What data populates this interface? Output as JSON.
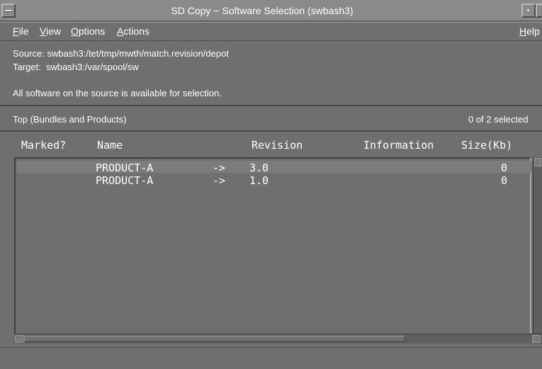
{
  "window": {
    "title": "SD Copy − Software Selection (swbash3)"
  },
  "menubar": {
    "items": [
      {
        "label": "File",
        "mnemonic": "F",
        "rest": "ile"
      },
      {
        "label": "View",
        "mnemonic": "V",
        "rest": "iew"
      },
      {
        "label": "Options",
        "mnemonic": "O",
        "rest": "ptions"
      },
      {
        "label": "Actions",
        "mnemonic": "A",
        "rest": "ctions"
      }
    ],
    "help": {
      "label": "Help",
      "mnemonic": "H",
      "rest": "elp"
    }
  },
  "info": {
    "source": "Source: swbash3:/tet/tmp/mwth/match.revision/depot",
    "target": "Target:  swbash3:/var/spool/sw",
    "message": "All software on the source is available for selection."
  },
  "level": {
    "label": "Top (Bundles and Products)",
    "selection_count": "0 of 2 selected"
  },
  "columns": {
    "marked": "Marked?",
    "name": "Name",
    "revision": "Revision",
    "information": "Information",
    "size": "Size(Kb)"
  },
  "rows": [
    {
      "marked": "",
      "name": "PRODUCT-A",
      "arrow": "->",
      "revision": "3.0",
      "information": "",
      "size": "0",
      "selected": true
    },
    {
      "marked": "",
      "name": "PRODUCT-A",
      "arrow": "->",
      "revision": "1.0",
      "information": "",
      "size": "0",
      "selected": false
    }
  ],
  "colors": {
    "background": "#6f6f6f",
    "titlebar": "#8a8a8a",
    "text": "#ffffff",
    "selected_row": "#7c7c7c"
  }
}
